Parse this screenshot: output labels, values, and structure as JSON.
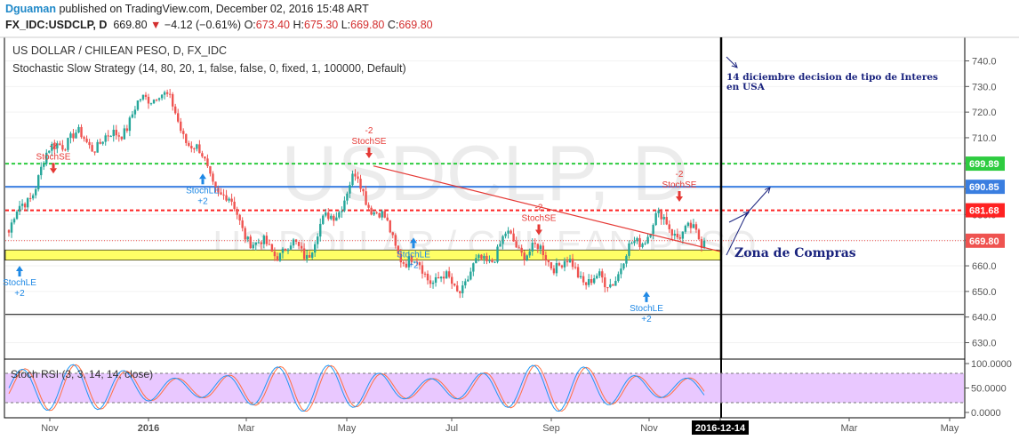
{
  "header": {
    "user": "Dguaman",
    "published": "published on TradingView.com, December 02, 2016 15:48 ART",
    "symbol": "FX_IDC:USDCLP, D",
    "price": "669.80",
    "arrow": "▼",
    "change": "−4.12 (−0.61%)",
    "o_label": "O:",
    "o_value": "673.40",
    "h_label": "H:",
    "h_value": "675.30",
    "l_label": "L:",
    "l_value": "669.80",
    "c_label": "C:",
    "c_value": "669.80"
  },
  "pane": {
    "title": "US DOLLAR / CHILEAN PESO, D, FX_IDC",
    "strategy": "Stochastic Slow Strategy (14, 80, 20, 1, false, false, 0, fixed, 1, 100000, Default)",
    "watermark_big": "USDCLP, D",
    "watermark_small": "US DOLLAR / CHILEAN PESO"
  },
  "annotations": {
    "note_text_1": "14 diciembre decision de tipo de Interes",
    "note_text_2": "en USA",
    "zona": "Zona de Compras",
    "cursor_date": "2016-12-14"
  },
  "colors": {
    "up": "#26a69a",
    "down": "#ef5350",
    "green_level": "#2ecc40",
    "blue_level": "#3a7ee0",
    "red_level": "#ff2222",
    "zone": "#ffff66",
    "trend": "#e53935",
    "rsi_k": "#2196f3",
    "rsi_d": "#ff7043",
    "rsi_band": "#e0b0ff"
  },
  "chart_data": {
    "type": "candlestick",
    "x_ticks": [
      "Nov",
      "2016",
      "Mar",
      "May",
      "Jul",
      "Sep",
      "Nov",
      "2016-12-14",
      "Mar",
      "May"
    ],
    "ylim": [
      622,
      746
    ],
    "y_ticks": [
      630,
      640,
      650,
      660,
      670,
      680,
      690,
      700,
      710,
      720,
      730,
      740
    ],
    "price_labels": [
      {
        "value": 699.89,
        "label": "699.89",
        "color": "#2ecc40"
      },
      {
        "value": 690.85,
        "label": "690.85",
        "color": "#3a7ee0"
      },
      {
        "value": 681.68,
        "label": "681.68",
        "color": "#ff2222"
      },
      {
        "value": 669.8,
        "label": "669.80",
        "color": "#ef5350"
      }
    ],
    "levels": [
      {
        "value": 699.89,
        "style": "dashed",
        "color": "#2ecc40"
      },
      {
        "value": 690.85,
        "style": "solid",
        "color": "#3a7ee0"
      },
      {
        "value": 681.68,
        "style": "dashed",
        "color": "#ff2222"
      },
      {
        "value": 669.8,
        "style": "dotted",
        "color": "#ef5350"
      },
      {
        "value": 641.0,
        "style": "solid",
        "color": "#000000"
      }
    ],
    "zone": {
      "low": 662.2,
      "high": 666.2,
      "label": "Zona de Compras"
    },
    "closes_by_month": [
      {
        "month": "Oct",
        "close": 673
      },
      {
        "month": "Nov",
        "close": 710
      },
      {
        "month": "Dec",
        "close": 708
      },
      {
        "month": "Jan",
        "close": 730
      },
      {
        "month": "Feb",
        "close": 697
      },
      {
        "month": "Mar",
        "close": 667
      },
      {
        "month": "Apr",
        "close": 666
      },
      {
        "month": "May",
        "close": 694
      },
      {
        "month": "Jun",
        "close": 662
      },
      {
        "month": "Jul",
        "close": 651
      },
      {
        "month": "Aug",
        "close": 670
      },
      {
        "month": "Sep",
        "close": 662
      },
      {
        "month": "Oct",
        "close": 652
      },
      {
        "month": "Nov",
        "close": 678
      },
      {
        "month": "Dec",
        "close": 669.8
      }
    ],
    "signals": [
      {
        "label": "StochLE",
        "qty": "+2",
        "type": "long"
      },
      {
        "label": "StochSE",
        "qty": "-2",
        "type": "short"
      },
      {
        "label": "StochLE",
        "qty": "+2",
        "type": "long"
      },
      {
        "label": "StochSE",
        "qty": "-2",
        "type": "short"
      },
      {
        "label": "StochLE",
        "qty": "+2",
        "type": "long"
      },
      {
        "label": "StochSE",
        "qty": "-2",
        "type": "short"
      },
      {
        "label": "StochLE",
        "qty": "+2",
        "type": "long"
      },
      {
        "label": "StochSE",
        "qty": "-2",
        "type": "short"
      }
    ],
    "oscillator": {
      "title": "Stoch RSI (3, 3, 14, 14, close)",
      "ylim": [
        0,
        100
      ],
      "y_ticks": [
        "100.0000",
        "50.0000",
        "0.0000"
      ],
      "band": [
        20,
        80
      ]
    }
  }
}
